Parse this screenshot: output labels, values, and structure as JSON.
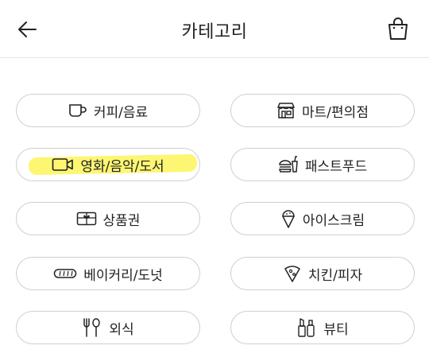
{
  "header": {
    "title": "카테고리",
    "back_icon": "arrow-left-icon",
    "cart_icon": "shopping-bag-icon"
  },
  "categories": [
    {
      "label": "커피/음료",
      "icon": "coffee-cup-icon"
    },
    {
      "label": "마트/편의점",
      "icon": "store-icon"
    },
    {
      "label": "영화/음악/도서",
      "icon": "video-camera-icon",
      "highlighted": true
    },
    {
      "label": "패스트푸드",
      "icon": "burger-drink-icon"
    },
    {
      "label": "상품권",
      "icon": "gift-card-icon"
    },
    {
      "label": "아이스크림",
      "icon": "ice-cream-icon"
    },
    {
      "label": "베이커리/도넛",
      "icon": "bread-icon"
    },
    {
      "label": "치킨/피자",
      "icon": "pizza-slice-icon"
    },
    {
      "label": "외식",
      "icon": "fork-spoon-icon"
    },
    {
      "label": "뷰티",
      "icon": "lipstick-icon"
    }
  ],
  "colors": {
    "highlight": "#fbf45a",
    "pill_border": "#cfcfcf",
    "text": "#222222"
  }
}
